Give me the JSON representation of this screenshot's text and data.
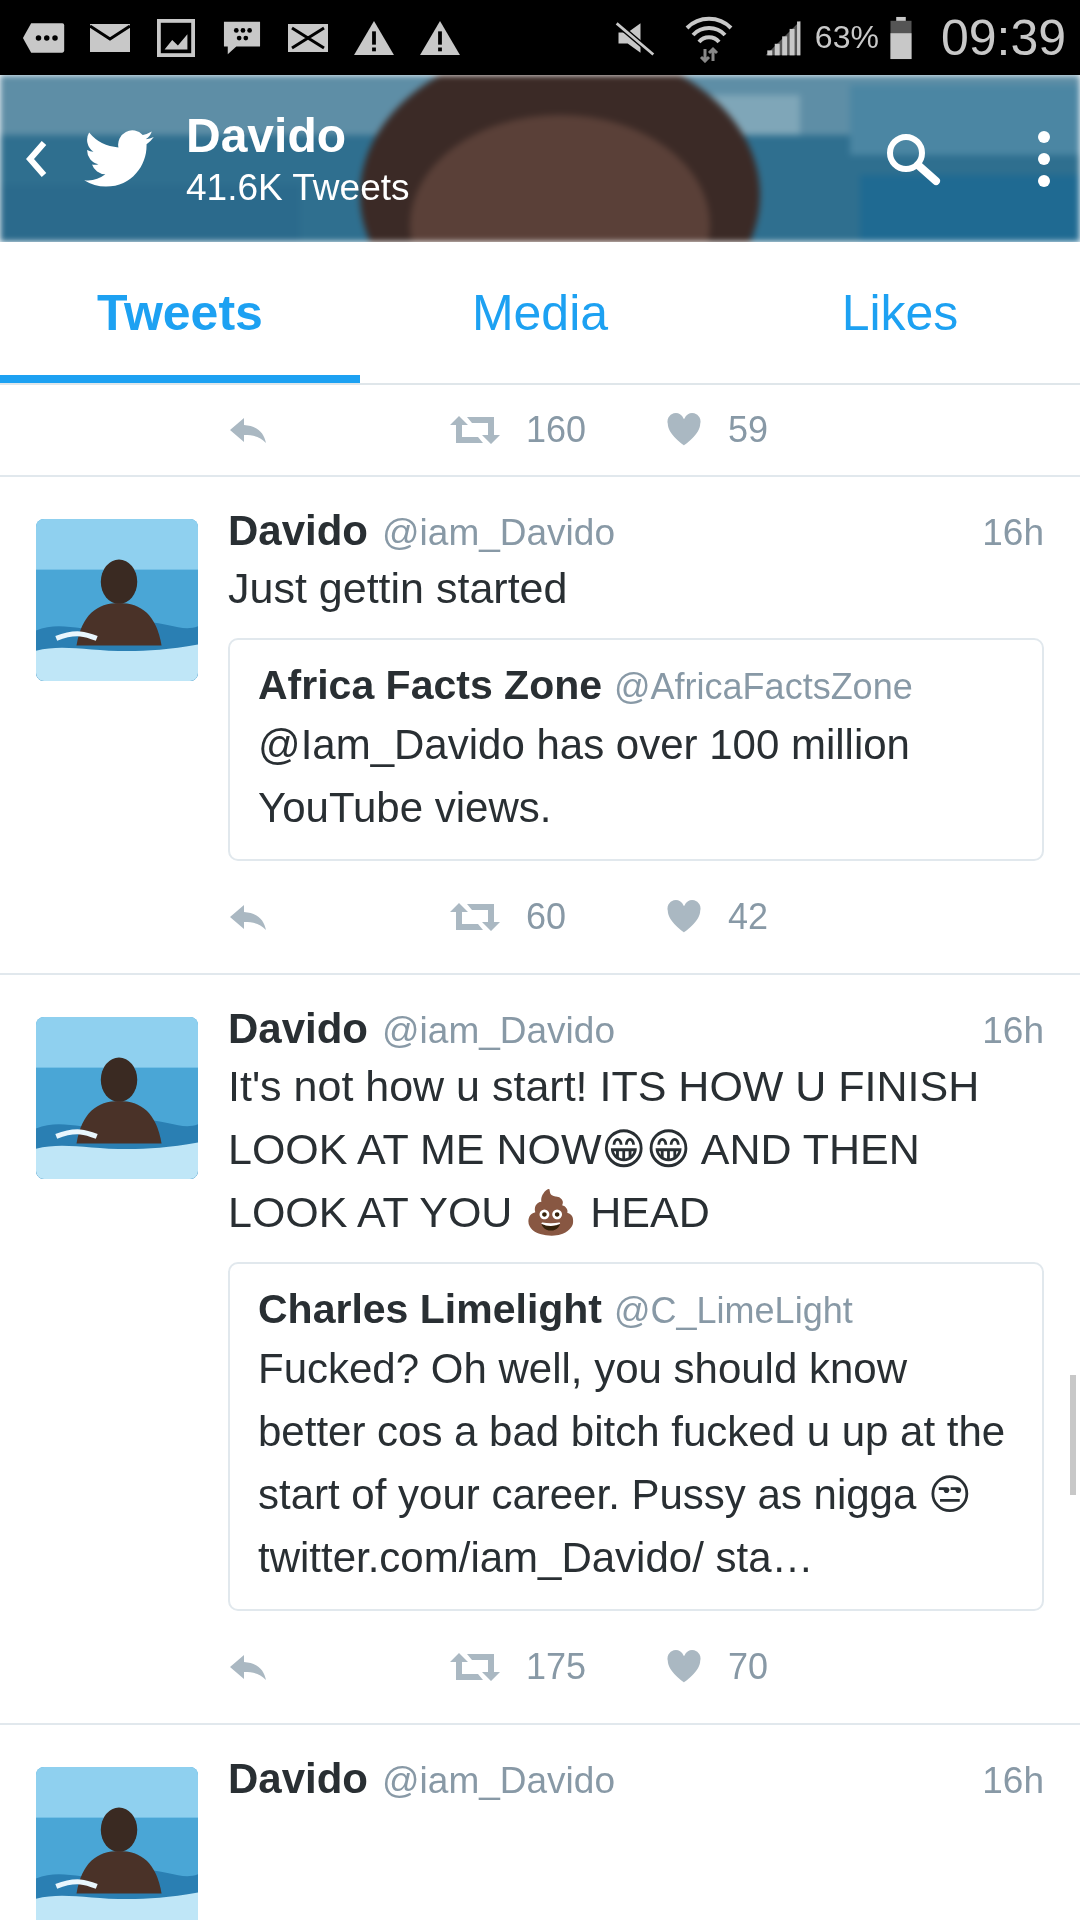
{
  "status_bar": {
    "battery": "63%",
    "time": "09:39"
  },
  "header": {
    "name": "Davido",
    "subtitle": "41.6K Tweets"
  },
  "tabs": [
    {
      "label": "Tweets",
      "selected": true
    },
    {
      "label": "Media",
      "selected": false
    },
    {
      "label": "Likes",
      "selected": false
    }
  ],
  "tweets": [
    {
      "kind": "actions",
      "retweets": "160",
      "likes": "59"
    },
    {
      "kind": "full",
      "name": "Davido",
      "handle": "@iam_Davido",
      "time": "16h",
      "text": "Just gettin started",
      "quote": {
        "name": "Africa Facts Zone",
        "handle": "@AfricaFactsZone",
        "text": "@Iam_Davido has over 100 million YouTube views."
      },
      "retweets": "60",
      "likes": "42"
    },
    {
      "kind": "full",
      "name": "Davido",
      "handle": "@iam_Davido",
      "time": "16h",
      "text": "It's not how u start! ITS HOW U FINISH LOOK AT ME NOW😁😁 AND THEN LOOK AT YOU 💩 HEAD",
      "quote": {
        "name": "Charles Limelight",
        "handle": "@C_LimeLight",
        "text": "Fucked? Oh well, you should know better cos a bad bitch fucked u up at the start of your career. Pussy as nigga 😒 twitter.com/iam_Davido/ sta…"
      },
      "retweets": "175",
      "likes": "70"
    },
    {
      "kind": "head",
      "name": "Davido",
      "handle": "@iam_Davido",
      "time": "16h"
    }
  ]
}
